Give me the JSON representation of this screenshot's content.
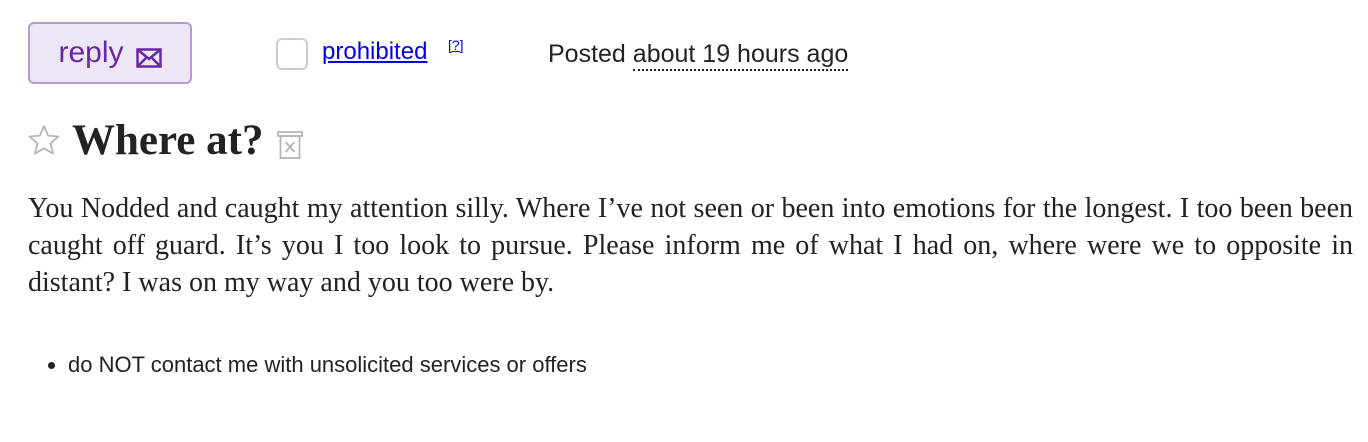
{
  "header": {
    "reply_label": "reply",
    "prohibited_label": "prohibited",
    "help_label": "[?]",
    "posted_prefix": "Posted",
    "posted_time": "about 19 hours ago"
  },
  "post": {
    "title": "Where at?",
    "body": "You Nodded and caught my attention silly. Where I’ve not seen or been into emotions for the longest. I too been been caught off guard. It’s you I too look to pursue. Please inform me of what I had on, where were we to opposite in distant? I was on my way and you too were by."
  },
  "notices": [
    "do NOT contact me with unsolicited services or offers"
  ],
  "colors": {
    "reply_text": "#6a27a5",
    "reply_border": "#b69ad6",
    "reply_background": "#ede6f5",
    "link": "#0000ee",
    "text": "#222222"
  },
  "icons": {
    "reply": "envelope-icon",
    "favorite": "star-icon",
    "hide": "trash-icon"
  }
}
